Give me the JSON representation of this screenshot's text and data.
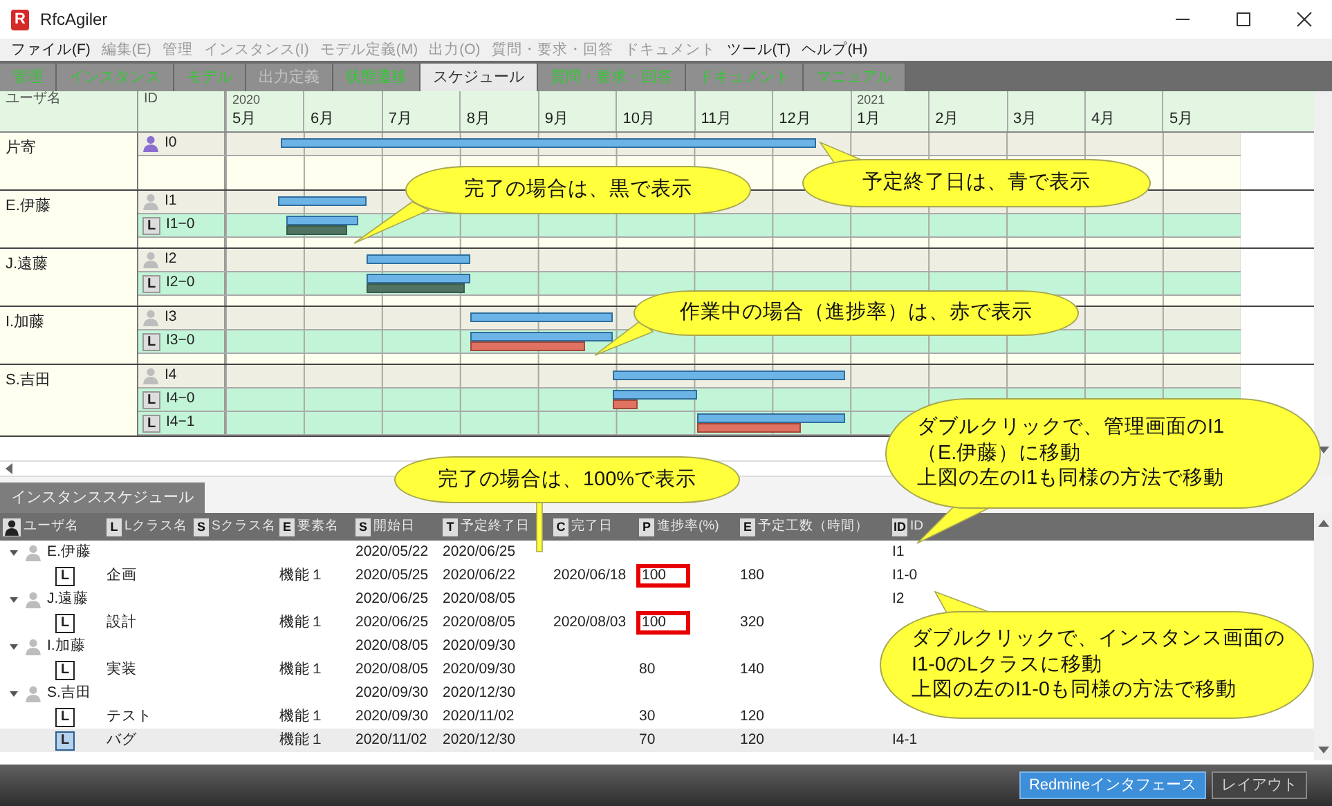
{
  "window": {
    "logo": "R",
    "title": "RfcAgiler"
  },
  "menu": [
    {
      "label": "ファイル(F)",
      "disabled": false
    },
    {
      "label": "編集(E)",
      "disabled": true
    },
    {
      "label": "管理",
      "disabled": true
    },
    {
      "label": "インスタンス(I)",
      "disabled": true
    },
    {
      "label": "モデル定義(M)",
      "disabled": true
    },
    {
      "label": "出力(O)",
      "disabled": true
    },
    {
      "label": "質問・要求・回答",
      "disabled": true
    },
    {
      "label": "ドキュメント",
      "disabled": true
    },
    {
      "label": "ツール(T)",
      "disabled": false
    },
    {
      "label": "ヘルプ(H)",
      "disabled": false
    }
  ],
  "tabs": [
    {
      "label": "管理",
      "selected": false,
      "disabled": false
    },
    {
      "label": "インスタンス",
      "selected": false,
      "disabled": false
    },
    {
      "label": "モデル",
      "selected": false,
      "disabled": false
    },
    {
      "label": "出力定義",
      "selected": false,
      "disabled": true
    },
    {
      "label": "状態遷移",
      "selected": false,
      "disabled": false
    },
    {
      "label": "スケジュール",
      "selected": true,
      "disabled": false
    },
    {
      "label": "質問・要求・回答",
      "selected": false,
      "disabled": false
    },
    {
      "label": "ドキュメント",
      "selected": false,
      "disabled": false
    },
    {
      "label": "マニュアル",
      "selected": false,
      "disabled": false
    }
  ],
  "gantt": {
    "columns": [
      "ユーザ名",
      "ID"
    ],
    "months": [
      {
        "label": "5月",
        "year": "2020"
      },
      {
        "label": "6月"
      },
      {
        "label": "7月"
      },
      {
        "label": "8月"
      },
      {
        "label": "9月"
      },
      {
        "label": "10月"
      },
      {
        "label": "11月"
      },
      {
        "label": "12月"
      },
      {
        "label": "1月",
        "year": "2021"
      },
      {
        "label": "2月"
      },
      {
        "label": "3月"
      },
      {
        "label": "4月"
      },
      {
        "label": "5月"
      }
    ],
    "groups": [
      {
        "user": "片寄",
        "rows": [
          {
            "kind": "user",
            "label": "I0",
            "color": "#8a6fd1"
          }
        ]
      },
      {
        "user": "E.伊藤",
        "rows": [
          {
            "kind": "user",
            "label": "I1",
            "color": "#bdbdbd"
          },
          {
            "kind": "class",
            "badge": "L",
            "label": "I1−0"
          }
        ]
      },
      {
        "user": "J.遠藤",
        "rows": [
          {
            "kind": "user",
            "label": "I2",
            "color": "#bdbdbd"
          },
          {
            "kind": "class",
            "badge": "L",
            "label": "I2−0"
          }
        ]
      },
      {
        "user": "I.加藤",
        "rows": [
          {
            "kind": "user",
            "label": "I3",
            "color": "#bdbdbd"
          },
          {
            "kind": "class",
            "badge": "L",
            "label": "I3−0",
            "level": 0.8
          }
        ]
      },
      {
        "user": "S.吉田",
        "rows": [
          {
            "kind": "user",
            "label": "I4",
            "color": "#bdbdbd"
          },
          {
            "kind": "class",
            "badge": "L",
            "label": "I4−0",
            "level": 0.3
          },
          {
            "kind": "class",
            "badge": "L",
            "label": "I4−1",
            "level": 0.7
          }
        ]
      }
    ]
  },
  "table": {
    "tab": "インスタンススケジュール",
    "columns": [
      {
        "kind": "person",
        "label": "ユーザ名"
      },
      {
        "kind": "letter",
        "letter": "L",
        "label": "Lクラス名"
      },
      {
        "kind": "letter",
        "letter": "S",
        "label": "Sクラス名"
      },
      {
        "kind": "letter",
        "letter": "E",
        "label": "要素名"
      },
      {
        "kind": "letter",
        "letter": "S",
        "label": "開始日"
      },
      {
        "kind": "letter",
        "letter": "T",
        "label": "予定終了日"
      },
      {
        "kind": "letter",
        "letter": "C",
        "label": "完了日"
      },
      {
        "kind": "letter",
        "letter": "P",
        "label": "進捗率(%)"
      },
      {
        "kind": "letter",
        "letter": "E",
        "label": "予定工数（時間）"
      },
      {
        "kind": "letter",
        "letter": "ID",
        "label": "ID"
      }
    ],
    "users": [
      {
        "name": "E.伊藤",
        "expanded": true,
        "selected": false,
        "start": "2020/05/22",
        "end": "2020/06/25",
        "id": "I1",
        "children": [
          {
            "badge": "L",
            "lclass": "企画",
            "element": "機能１",
            "start": "2020/05/25",
            "end": "2020/06/22",
            "done": "2020/06/18",
            "progress": "100",
            "effort": "180",
            "id": "I1-0",
            "highlighted": true,
            "selected": false
          }
        ]
      },
      {
        "name": "J.遠藤",
        "expanded": true,
        "selected": false,
        "start": "2020/06/25",
        "end": "2020/08/05",
        "id": "I2",
        "children": [
          {
            "badge": "L",
            "lclass": "設計",
            "element": "機能１",
            "start": "2020/06/25",
            "end": "2020/08/05",
            "done": "2020/08/03",
            "progress": "100",
            "effort": "320",
            "highlighted": true,
            "selected": false
          }
        ]
      },
      {
        "name": "I.加藤",
        "expanded": true,
        "selected": false,
        "start": "2020/08/05",
        "end": "2020/09/30",
        "children": [
          {
            "badge": "L",
            "lclass": "実装",
            "element": "機能１",
            "start": "2020/08/05",
            "end": "2020/09/30",
            "progress": "80",
            "effort": "140",
            "highlighted": false,
            "selected": false
          }
        ]
      },
      {
        "name": "S.吉田",
        "expanded": true,
        "selected": false,
        "start": "2020/09/30",
        "end": "2020/12/30",
        "children": [
          {
            "badge": "L",
            "lclass": "テスト",
            "element": "機能１",
            "start": "2020/09/30",
            "end": "2020/11/02",
            "progress": "30",
            "effort": "120",
            "highlighted": false,
            "selected": false
          },
          {
            "badge": "L",
            "lclass": "バグ",
            "element": "機能１",
            "start": "2020/11/02",
            "end": "2020/12/30",
            "progress": "70",
            "effort": "120",
            "id": "I4-1",
            "highlighted": false,
            "selected": true
          }
        ]
      }
    ]
  },
  "callouts": [
    {
      "lines": [
        "完了の場合は、黒で表示"
      ]
    },
    {
      "lines": [
        "予定終了日は、青で表示"
      ]
    },
    {
      "lines": [
        "作業中の場合（進捗率）は、赤で表示"
      ]
    },
    {
      "lines": [
        "完了の場合は、100%で表示"
      ]
    },
    {
      "lines": [
        "ダブルクリックで、管理画面のI1",
        "（E.伊藤）に移動",
        "上図の左のI1も同様の方法で移動"
      ]
    },
    {
      "lines": [
        "ダブルクリックで、インスタンス画面の",
        "I1-0のLクラスに移動",
        "上図の左のI1-0も同様の方法で移動"
      ]
    }
  ],
  "buttons": [
    {
      "label": "Redmineインタフェース",
      "selected": true
    },
    {
      "label": "レイアウト",
      "selected": false
    }
  ]
}
